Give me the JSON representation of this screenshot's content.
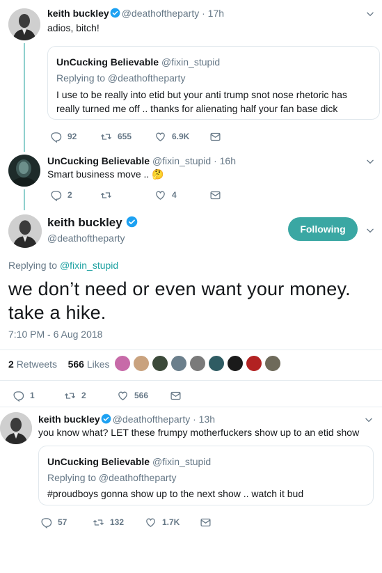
{
  "colors": {
    "accent": "#3aa7a3",
    "thread_line": "#8fd0cd",
    "link": "#1da1a1",
    "verified": "#1da1f2",
    "secondary": "#657786"
  },
  "tweet1": {
    "name": "keith buckley",
    "handle": "@deathoftheparty",
    "time": "· 17h",
    "text": "adios, bitch!",
    "quote": {
      "name": "UnCucking Believable",
      "handle": "@fixin_stupid",
      "replying": "Replying to @deathoftheparty",
      "text": "I use to be really into etid but your anti trump snot nose rhetoric has really turned me off .. thanks for alienating half your fan base dick"
    },
    "replies": "92",
    "retweets": "655",
    "likes": "6.9K"
  },
  "tweet2": {
    "name": "UnCucking Believable",
    "handle": "@fixin_stupid",
    "time": "· 16h",
    "text": "Smart business move .. 🤔",
    "replies": "2",
    "retweets": "",
    "likes": "4"
  },
  "main": {
    "name": "keith buckley",
    "handle": "@deathoftheparty",
    "follow_label": "Following",
    "replying_prefix": "Replying to ",
    "replying_link": "@fixin_stupid",
    "text": "we don’t need or even want your money. take a hike.",
    "timestamp": "7:10 PM - 6 Aug 2018",
    "retweets_count": "2",
    "retweets_label": "Retweets",
    "likes_count": "566",
    "likes_label": "Likes",
    "likers": [
      "#c76aa8",
      "#c9a27e",
      "#3c4a3a",
      "#6b7f8c",
      "#7a7a7a",
      "#2f5c63",
      "#1a1a1a",
      "#b22222",
      "#6e6a5a"
    ],
    "replies": "1",
    "retweets": "2",
    "likes": "566"
  },
  "tweet4": {
    "name": "keith buckley",
    "handle": "@deathoftheparty",
    "time": "· 13h",
    "text": "you know what? LET these frumpy motherfuckers show up to an etid show",
    "quote": {
      "name": "UnCucking Believable",
      "handle": "@fixin_stupid",
      "replying": "Replying to @deathoftheparty",
      "text": "#proudboys gonna show up to the next show .. watch it bud"
    },
    "replies": "57",
    "retweets": "132",
    "likes": "1.7K"
  }
}
